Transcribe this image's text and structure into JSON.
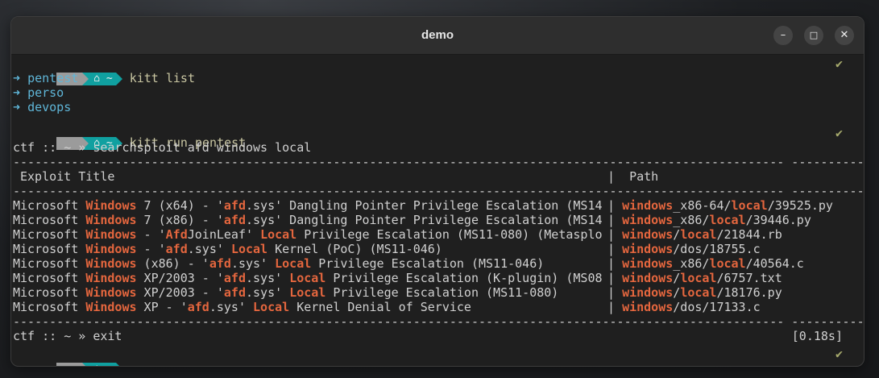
{
  "window": {
    "title": "demo",
    "buttons": {
      "minimize": "–",
      "maximize": "□",
      "close": "✕"
    }
  },
  "prompt": {
    "home_icon": "⌂",
    "tilde": "~",
    "check": "✔"
  },
  "cmd1": "kitt list",
  "list_items": [
    "pentest",
    "perso",
    "devops"
  ],
  "list_arrow": "➜",
  "cmd2": "kitt run pentest",
  "shell_prompt": "ctf :: ~ » ",
  "search_cmd": "searchsploit afd windows local",
  "separator_left": "----------------------------------------------------------------------------------------------------------",
  "separator_right": "-----------------------------------",
  "header_title": "Exploit Title",
  "header_path": "Path",
  "pipe": "|",
  "results": [
    {
      "title": [
        "Microsoft ",
        "Windows",
        " 7 (x64) - '",
        "afd",
        ".sys' Dangling Pointer Privilege Escalation (MS14 "
      ],
      "path": [
        "windows",
        "_x86-64/",
        "local",
        "/39525.py"
      ]
    },
    {
      "title": [
        "Microsoft ",
        "Windows",
        " 7 (x86) - '",
        "afd",
        ".sys' Dangling Pointer Privilege Escalation (MS14 "
      ],
      "path": [
        "windows",
        "_x86/",
        "local",
        "/39446.py"
      ]
    },
    {
      "title": [
        "Microsoft ",
        "Windows",
        " - '",
        "Afd",
        "JoinLeaf' ",
        "Local",
        " Privilege Escalation (MS11-080) (Metasplo "
      ],
      "path": [
        "windows",
        "/",
        "local",
        "/21844.rb"
      ]
    },
    {
      "title": [
        "Microsoft ",
        "Windows",
        " - '",
        "afd",
        ".sys' ",
        "Local",
        " Kernel (PoC) (MS11-046)                  "
      ],
      "path": [
        "windows",
        "/dos/18755.c"
      ]
    },
    {
      "title": [
        "Microsoft ",
        "Windows",
        " (x86) - '",
        "afd",
        ".sys' ",
        "Local",
        " Privilege Escalation (MS11-046)        "
      ],
      "path": [
        "windows",
        "_x86/",
        "local",
        "/40564.c"
      ]
    },
    {
      "title": [
        "Microsoft ",
        "Windows",
        " XP/2003 - '",
        "afd",
        ".sys' ",
        "Local",
        " Privilege Escalation (K-plugin) (MS08 "
      ],
      "path": [
        "windows",
        "/",
        "local",
        "/6757.txt"
      ]
    },
    {
      "title": [
        "Microsoft ",
        "Windows",
        " XP/2003 - '",
        "afd",
        ".sys' ",
        "Local",
        " Privilege Escalation (MS11-080)       "
      ],
      "path": [
        "windows",
        "/",
        "local",
        "/18176.py"
      ]
    },
    {
      "title": [
        "Microsoft ",
        "Windows",
        " XP - '",
        "afd",
        ".sys' ",
        "Local",
        " Kernel Denial of Service                      "
      ],
      "path": [
        "windows",
        "/dos/17133.c"
      ]
    }
  ],
  "exit_cmd": "exit",
  "timing": "[0.18s]"
}
